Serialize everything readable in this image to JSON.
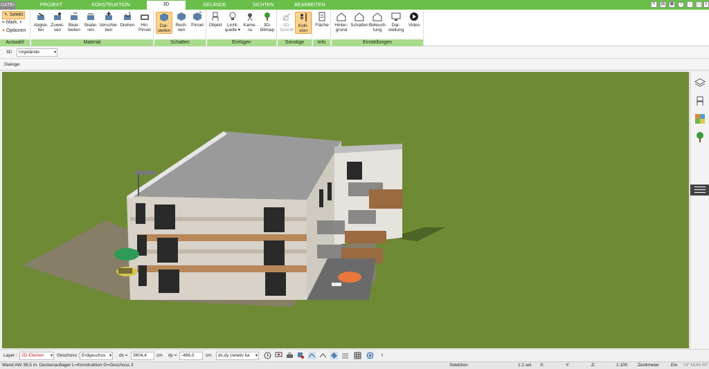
{
  "tabs": [
    "DATEI",
    "PROJEKT",
    "KONSTRUKTION",
    "3D",
    "GELÄNDE",
    "SICHTEN",
    "BEARBEITEN"
  ],
  "auswahl": {
    "selekt": "Selekt",
    "mark": "Mark.",
    "optionen": "Optionen",
    "label": "Auswahl"
  },
  "material": {
    "buttons": [
      "Abgrei-\nfen",
      "Zuwei-\nsen",
      "Bear-\nbeiten",
      "Skalie-\nren",
      "Verschie-\nben",
      "Drehen",
      "Hin.\nPinsel"
    ],
    "label": "Material"
  },
  "schatten": {
    "buttons": [
      "Dar-\nstellen",
      "Rech-\nnen",
      "Pinsel"
    ],
    "label": "Schatten"
  },
  "einfuegen": {
    "buttons": [
      "Objekt",
      "Licht-\nquelle ▾",
      "Kame-\nra",
      "3D-\nBitmap"
    ],
    "label": "Einfügen"
  },
  "sonstige": {
    "buttons": [
      "3D-\nSchnitt",
      "Kolli-\nsion"
    ],
    "label": "Sonstige"
  },
  "info": {
    "buttons": [
      "Fläche"
    ],
    "label": "Info"
  },
  "einstellungen": {
    "buttons": [
      "Hinter-\ngrund",
      "Schatten",
      "Beleuch-\ntung",
      "Dar-\nstellung",
      "Video"
    ],
    "label": "Einstellungen"
  },
  "view": {
    "mode": "3D",
    "terrain": "Urgelände"
  },
  "dialoge": "Dialoge:",
  "bottom": {
    "layer_label": "Layer :",
    "layer_value": "2D-Elemen",
    "geschoss_label": "Geschoss :",
    "geschoss_value": "Erdgeschos",
    "dx_label": "dx =",
    "dx_value": "3604,4",
    "dy_label": "dy =",
    "dy_value": "-486,0",
    "unit": "cm",
    "mode": "dx,dy (relativ ka"
  },
  "status": {
    "text": "Wand AW 36,5 m. Deckenauflager L=Konstruktion G=Geschoss 3",
    "selektion": "Selektion",
    "sel": "1:1 sel",
    "x": "X:",
    "y": "Y:",
    "z": "Z:",
    "scale": "1:100",
    "unit": "Zentimeter",
    "ein": "Ein",
    "flags": "UF NUM RF"
  },
  "colors": {
    "green": "#6abf4b",
    "grass": "#6e8a34",
    "group_label": "#a9db8c",
    "active": "#fbd38d"
  }
}
